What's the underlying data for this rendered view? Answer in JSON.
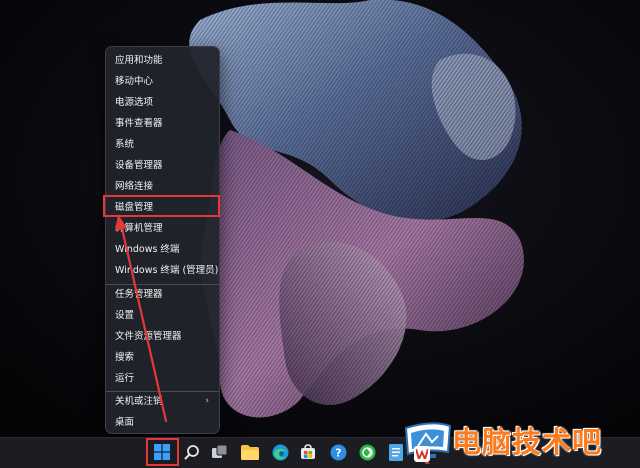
{
  "context_menu": {
    "items": [
      {
        "label": "应用和功能"
      },
      {
        "label": "移动中心"
      },
      {
        "label": "电源选项"
      },
      {
        "label": "事件查看器"
      },
      {
        "label": "系统"
      },
      {
        "label": "设备管理器"
      },
      {
        "label": "网络连接"
      },
      {
        "label": "磁盘管理",
        "highlighted": true
      },
      {
        "label": "计算机管理"
      },
      {
        "label": "Windows 终端"
      },
      {
        "label": "Windows 终端 (管理员)"
      },
      {
        "label": "任务管理器"
      },
      {
        "label": "设置"
      },
      {
        "label": "文件资源管理器"
      },
      {
        "label": "搜索"
      },
      {
        "label": "运行"
      },
      {
        "label": "关机或注销",
        "has_submenu": true
      },
      {
        "label": "桌面"
      }
    ]
  },
  "icons": {
    "submenu_arrow": "›"
  },
  "watermark": {
    "text": "电脑技术吧"
  },
  "colors": {
    "annotation_red": "#e23838",
    "watermark_orange": "#ff7a1a",
    "taskbar": "#1c1d22",
    "menu_bg": "#22242c"
  }
}
